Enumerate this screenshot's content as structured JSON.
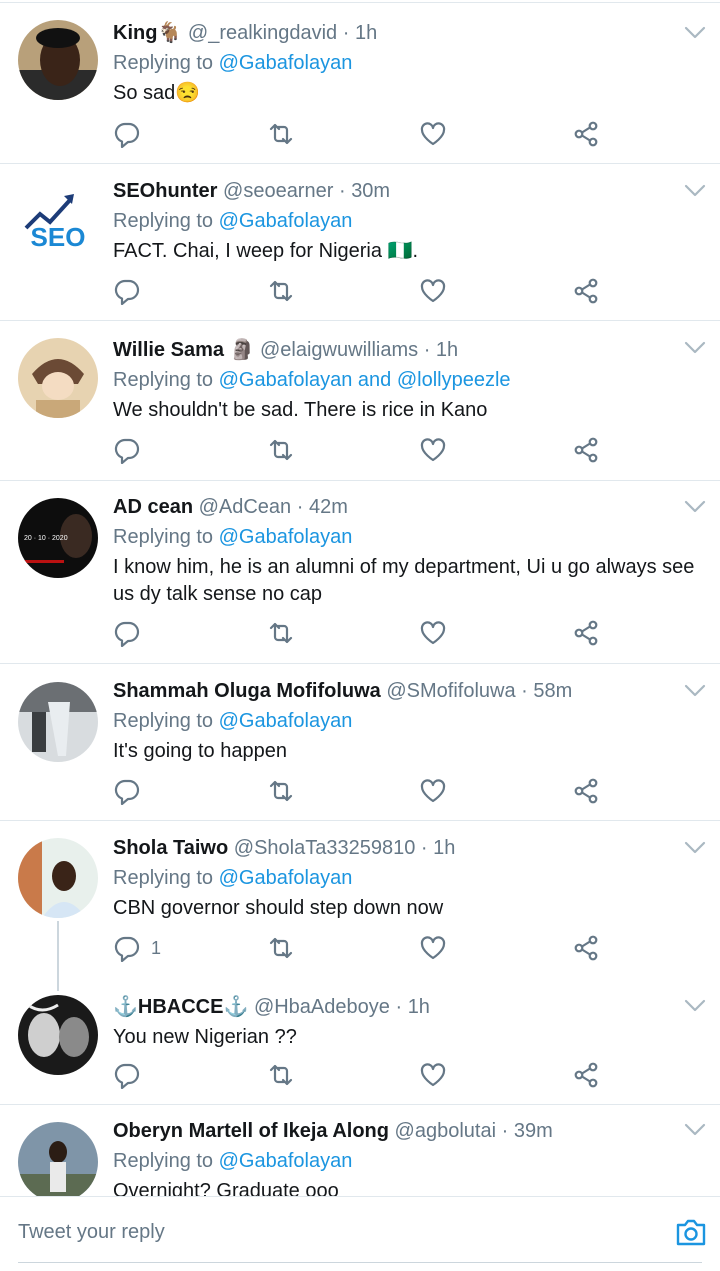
{
  "replying_prefix": "Replying to",
  "tweets": [
    {
      "name": "King🐐",
      "handle": "@_realkingdavid",
      "time": "1h",
      "reply_to": "@Gabafolayan",
      "reply_to_2": "",
      "text": "So sad😒",
      "reply_count": ""
    },
    {
      "name": "SEOhunter",
      "handle": "@seoearner",
      "time": "30m",
      "reply_to": "@Gabafolayan",
      "reply_to_2": "",
      "text": "FACT. Chai, I weep for Nigeria 🇳🇬.",
      "reply_count": ""
    },
    {
      "name": "Willie Sama 🗿",
      "handle": "@elaigwuwilliams",
      "time": "1h",
      "reply_to": "@Gabafolayan",
      "reply_to_2": "@lollypeezle",
      "text": "We shouldn't be sad. There is rice in Kano",
      "reply_count": ""
    },
    {
      "name": "AD cean",
      "handle": "@AdCean",
      "time": "42m",
      "reply_to": "@Gabafolayan",
      "reply_to_2": "",
      "text": "I know him, he is an alumni of my department, Ui u go always see us dy talk sense no cap",
      "reply_count": ""
    },
    {
      "name": "Shammah Oluga Mofifoluwa",
      "handle": "@SMofifoluwa",
      "time": "58m",
      "reply_to": "@Gabafolayan",
      "reply_to_2": "",
      "text": "It's going to happen",
      "reply_count": ""
    },
    {
      "name": "Shola Taiwo",
      "handle": "@SholaTa33259810",
      "time": "1h",
      "reply_to": "@Gabafolayan",
      "reply_to_2": "",
      "text": "CBN governor should step down now",
      "reply_count": "1"
    },
    {
      "name": "⚓HBACCE⚓",
      "handle": "@HbaAdeboye",
      "time": "1h",
      "reply_to": "",
      "reply_to_2": "",
      "text": "You new Nigerian ??",
      "reply_count": ""
    },
    {
      "name": "Oberyn Martell of Ikeja Along",
      "handle": "@agbolutai",
      "time": "39m",
      "reply_to": "@Gabafolayan",
      "reply_to_2": "",
      "text": "Overnight? Graduate ooo",
      "reply_count": ""
    }
  ],
  "reply_and": "and",
  "avatar_text": {
    "seo": "SEO",
    "ad_date": "20 · 10 · 2020"
  },
  "composer": {
    "placeholder": "Tweet your reply"
  },
  "colors": {
    "accent": "#1b95e0",
    "muted": "#657786",
    "divider": "#e1e8ed"
  },
  "icons": [
    "reply-icon",
    "retweet-icon",
    "like-icon",
    "share-icon",
    "chevron-down-icon",
    "camera-icon"
  ]
}
